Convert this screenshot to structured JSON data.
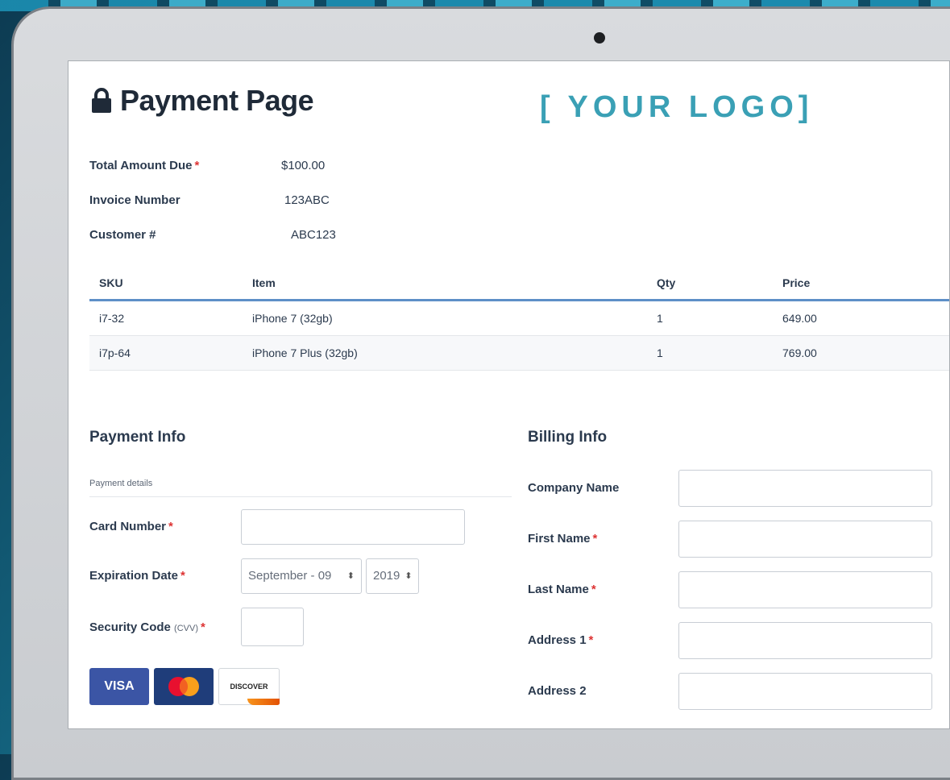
{
  "page": {
    "title": "Payment Page",
    "logo_text": "[ YOUR LOGO]"
  },
  "summary": [
    {
      "label": "Total Amount Due",
      "required": "*",
      "value": "$100.00"
    },
    {
      "label": "Invoice Number",
      "required": "",
      "value": "123ABC"
    },
    {
      "label": "Customer #",
      "required": "",
      "value": "ABC123"
    }
  ],
  "items": {
    "headers": {
      "sku": "SKU",
      "item": "Item",
      "qty": "Qty",
      "price": "Price"
    },
    "rows": [
      {
        "sku": "i7-32",
        "item": "iPhone 7 (32gb)",
        "qty": "1",
        "price": "649.00"
      },
      {
        "sku": "i7p-64",
        "item": "iPhone 7 Plus (32gb)",
        "qty": "1",
        "price": "769.00"
      }
    ]
  },
  "payment": {
    "title": "Payment Info",
    "details_label": "Payment details",
    "card_number_label": "Card Number",
    "expiration_label": "Expiration Date",
    "exp_month": "September - 09",
    "exp_year": "2019",
    "security_label": "Security Code",
    "security_hint": "(CVV)",
    "required_mark": "*",
    "cards": {
      "visa": "VISA",
      "discover": "DISCOVER"
    }
  },
  "billing": {
    "title": "Billing Info",
    "fields": [
      {
        "label": "Company Name",
        "required": ""
      },
      {
        "label": "First Name",
        "required": "*"
      },
      {
        "label": "Last Name",
        "required": "*"
      },
      {
        "label": "Address 1",
        "required": "*"
      },
      {
        "label": "Address 2",
        "required": ""
      }
    ]
  },
  "colors": {
    "logo": "#3aa0b5",
    "accent_line": "#5d8fc7",
    "required": "#dd3333",
    "visa": "#3b55a5",
    "mastercard_bg": "#1f3d7a"
  }
}
